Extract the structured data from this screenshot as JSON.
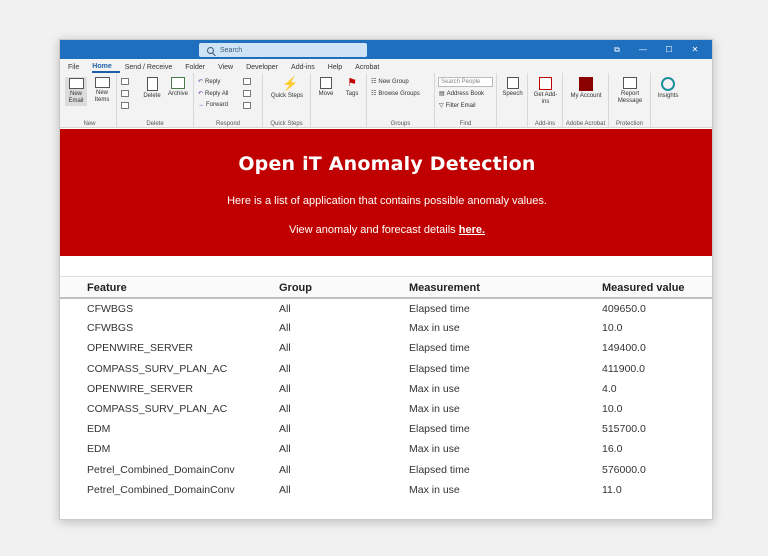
{
  "titlebar": {
    "search_placeholder": "Search",
    "controls": [
      "⧉",
      "—",
      "☐",
      "✕"
    ]
  },
  "menu_tabs": [
    "File",
    "Home",
    "Send / Receive",
    "Folder",
    "View",
    "Developer",
    "Add-ins",
    "Help",
    "Acrobat"
  ],
  "active_tab": "Home",
  "ribbon": {
    "new_email": "New Email",
    "new_items": "New Items",
    "group_new": "New",
    "delete": "Delete",
    "archive": "Archive",
    "group_delete": "Delete",
    "reply": "Reply",
    "reply_all": "Reply All",
    "forward": "Forward",
    "group_respond": "Respond",
    "quick_steps": "Quick Steps",
    "group_quick_steps": "Quick Steps",
    "move": "Move",
    "tags": "Tags",
    "new_group": "New Group",
    "browse_groups": "Browse Groups",
    "group_groups": "Groups",
    "search_people": "Search People",
    "address_book": "Address Book",
    "filter_email": "Filter Email",
    "group_find": "Find",
    "speech": "Speech",
    "get_addins": "Get Add-ins",
    "group_addins": "Add-ins",
    "my_account": "My Account",
    "group_adobe": "Adobe Acrobat",
    "report_message": "Report Message",
    "group_protection": "Protection",
    "insights": "Insights"
  },
  "banner": {
    "title": "Open iT Anomaly Detection",
    "subtitle": "Here is a list of application that contains possible anomaly values.",
    "forecast_text": "View anomaly and forecast details",
    "forecast_link": "here."
  },
  "table": {
    "headers": [
      "Feature",
      "Group",
      "Measurement",
      "Measured value"
    ],
    "rows": [
      [
        "CFWBGS",
        "All",
        "Elapsed time",
        "409650.0"
      ],
      [
        "CFWBGS",
        "All",
        "Max in use",
        "10.0"
      ],
      [
        "OPENWIRE_SERVER",
        "All",
        "Elapsed time",
        "149400.0"
      ],
      [
        "COMPASS_SURV_PLAN_AC",
        "All",
        "Elapsed time",
        "411900.0"
      ],
      [
        "OPENWIRE_SERVER",
        "All",
        "Max in use",
        "4.0"
      ],
      [
        "COMPASS_SURV_PLAN_AC",
        "All",
        "Max in use",
        "10.0"
      ],
      [
        "EDM",
        "All",
        "Elapsed time",
        "515700.0"
      ],
      [
        "EDM",
        "All",
        "Max in use",
        "16.0"
      ],
      [
        "Petrel_Combined_DomainConv",
        "All",
        "Elapsed time",
        "576000.0"
      ],
      [
        "Petrel_Combined_DomainConv",
        "All",
        "Max in use",
        "11.0"
      ]
    ]
  },
  "colors": {
    "titlebar": "#1f6fbf",
    "banner": "#c00000",
    "accent": "#1f5fa8"
  }
}
